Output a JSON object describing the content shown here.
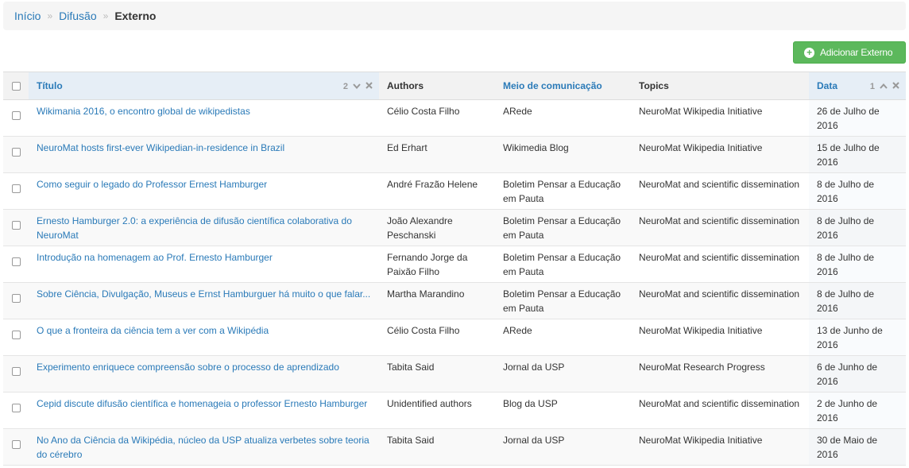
{
  "breadcrumb": {
    "home": "Início",
    "section": "Difusão",
    "current": "Externo",
    "separator": "»"
  },
  "actions": {
    "add_label": "Adicionar Externo",
    "add_icon": "plus-circle-icon"
  },
  "table": {
    "headers": {
      "title": "Título",
      "authors": "Authors",
      "media": "Meio de comunicação",
      "topics": "Topics",
      "date": "Data"
    },
    "title_sort": {
      "priority": "2",
      "direction_icon": "chevron-down-icon",
      "remove_icon": "close-icon"
    },
    "date_sort": {
      "priority": "1",
      "direction_icon": "chevron-up-icon",
      "remove_icon": "close-icon"
    },
    "rows": [
      {
        "title": "Wikimania 2016, o encontro global de wikipedistas",
        "authors": "Célio Costa Filho",
        "media": "ARede",
        "topics": "NeuroMat Wikipedia Initiative",
        "date": "26 de Julho de 2016"
      },
      {
        "title": "NeuroMat hosts first-ever Wikipedian-in-residence in Brazil",
        "authors": "Ed Erhart",
        "media": "Wikimedia Blog",
        "topics": "NeuroMat Wikipedia Initiative",
        "date": "15 de Julho de 2016"
      },
      {
        "title": "Como seguir o legado do Professor Ernest Hamburger",
        "authors": "André Frazão Helene",
        "media": "Boletim Pensar a Educação em Pauta",
        "topics": "NeuroMat and scientific dissemination",
        "date": "8 de Julho de 2016"
      },
      {
        "title": "Ernesto Hamburger 2.0: a experiência de difusão científica colaborativa do NeuroMat",
        "authors": "João Alexandre Peschanski",
        "media": "Boletim Pensar a Educação em Pauta",
        "topics": "NeuroMat and scientific dissemination",
        "date": "8 de Julho de 2016"
      },
      {
        "title": "Introdução na homenagem ao Prof. Ernesto Hamburger",
        "authors": "Fernando Jorge da Paixão Filho",
        "media": "Boletim Pensar a Educação em Pauta",
        "topics": "NeuroMat and scientific dissemination",
        "date": "8 de Julho de 2016"
      },
      {
        "title": "Sobre Ciência, Divulgação, Museus e Ernst Hamburguer há muito o que falar...",
        "authors": "Martha Marandino",
        "media": "Boletim Pensar a Educação em Pauta",
        "topics": "NeuroMat and scientific dissemination",
        "date": "8 de Julho de 2016"
      },
      {
        "title": "O que a fronteira da ciência tem a ver com a Wikipédia",
        "authors": "Célio Costa Filho",
        "media": "ARede",
        "topics": "NeuroMat Wikipedia Initiative",
        "date": "13 de Junho de 2016"
      },
      {
        "title": "Experimento enriquece compreensão sobre o processo de aprendizado",
        "authors": "Tabita Said",
        "media": "Jornal da USP",
        "topics": "NeuroMat Research Progress",
        "date": "6 de Junho de 2016"
      },
      {
        "title": "Cepid discute difusão científica e homenageia o professor Ernesto Hamburger",
        "authors": "Unidentified authors",
        "media": "Blog da USP",
        "topics": "NeuroMat and scientific dissemination",
        "date": "2 de Junho de 2016"
      },
      {
        "title": "No Ano da Ciência da Wikipédia, núcleo da USP atualiza verbetes sobre teoria do cérebro",
        "authors": "Tabita Said",
        "media": "Jornal da USP",
        "topics": "NeuroMat Wikipedia Initiative",
        "date": "30 de Maio de 2016"
      }
    ]
  }
}
